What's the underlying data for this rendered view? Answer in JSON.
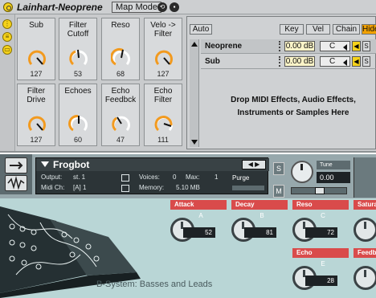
{
  "rack": {
    "title": "Lainhart-Neoprene",
    "map_mode_label": "Map Mode",
    "macros": [
      {
        "name": "Sub",
        "value": "127"
      },
      {
        "name": "Filter Cutoff",
        "value": "53"
      },
      {
        "name": "Reso",
        "value": "68"
      },
      {
        "name": "Velo -> Filter",
        "value": "127"
      },
      {
        "name": "Filter Drive",
        "value": "127"
      },
      {
        "name": "Echoes",
        "value": "60"
      },
      {
        "name": "Echo Feedbck",
        "value": "47"
      },
      {
        "name": "Echo Filter",
        "value": "111"
      }
    ],
    "chain_tabs": {
      "auto": "Auto",
      "key": "Key",
      "vel": "Vel",
      "chain": "Chain",
      "hide": "Hide"
    },
    "chains": [
      {
        "name": "Neoprene",
        "volume": "0.00 dB",
        "pan": "C",
        "solo": "S"
      },
      {
        "name": "Sub",
        "volume": "0.00 dB",
        "pan": "C",
        "solo": "S"
      }
    ],
    "drop_text": "Drop MIDI Effects, Audio Effects, Instruments or Samples Here"
  },
  "kontakt": {
    "instrument_name": "Frogbot",
    "output_label": "Output:",
    "output_value": "st. 1",
    "voices_label": "Voices:",
    "voices_value": "0",
    "max_label": "Max:",
    "max_value": "1",
    "purge_label": "Purge",
    "midi_label": "Midi Ch:",
    "midi_value": "[A] 1",
    "memory_label": "Memory:",
    "memory_value": "5.10 MB",
    "s_label": "S",
    "m_label": "M",
    "tune_label": "Tune",
    "tune_value": "0.00",
    "controls": [
      {
        "label": "Attack",
        "letter": "A",
        "value": "52"
      },
      {
        "label": "Decay",
        "letter": "B",
        "value": "81"
      },
      {
        "label": "Reso",
        "letter": "C",
        "value": "72"
      },
      {
        "label": "Saturat",
        "letter": "",
        "value": ""
      },
      {
        "label": "Echo",
        "letter": "E",
        "value": "28"
      },
      {
        "label": "Feedba",
        "letter": "",
        "value": ""
      }
    ],
    "footer": "B-System: Basses and Leads",
    "colors": {
      "accent_red": "#d94b4b",
      "panel_teal": "#b9d6d6"
    }
  }
}
